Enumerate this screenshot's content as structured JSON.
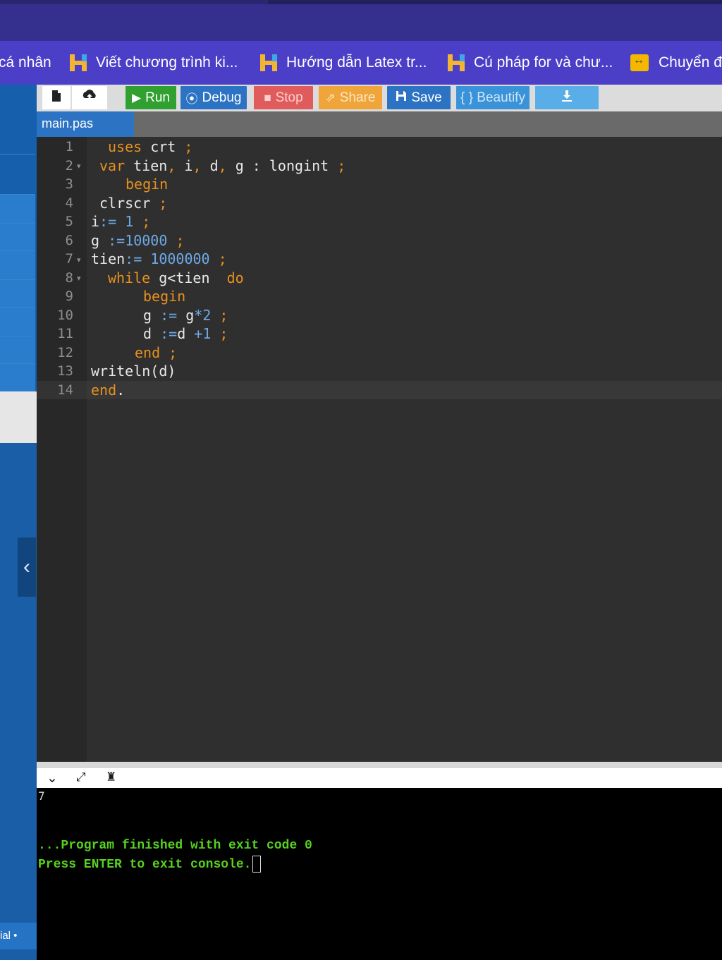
{
  "bookmarks": [
    {
      "label": "cá nhân",
      "icon": "none"
    },
    {
      "label": "Viết chương trình ki...",
      "icon": "h-logo-icon"
    },
    {
      "label": "Hướng dẫn Latex tr...",
      "icon": "h-logo-icon"
    },
    {
      "label": "Cú pháp for và chư...",
      "icon": "h-logo-icon"
    },
    {
      "label": "Chuyển đ",
      "icon": "convert-icon"
    }
  ],
  "toolbar": {
    "new_icon": "file-icon",
    "upload_icon": "upload-icon",
    "run_label": "Run",
    "debug_label": "Debug",
    "stop_label": "Stop",
    "share_label": "Share",
    "save_label": "Save",
    "beautify_label": "{ } Beautify",
    "download_icon": "download-icon",
    "colors": {
      "run": "#30a030",
      "debug": "#2c73c4",
      "stop": "#e05b5b",
      "share": "#f0a53a",
      "save": "#2c73c4",
      "beautify": "#3a93d8",
      "download": "#5aaee8"
    }
  },
  "editor": {
    "tab_label": "main.pas",
    "line_numbers": [
      "1",
      "2",
      "3",
      "4",
      "5",
      "6",
      "7",
      "8",
      "9",
      "10",
      "11",
      "12",
      "13",
      "14"
    ],
    "lines": [
      "uses crt ;",
      "var tien, i, d, g : longint ;",
      "begin",
      "clrscr ;",
      "i:= 1 ;",
      "g :=10000 ;",
      "tien:= 1000000 ;",
      "while g<tien  do",
      "begin",
      "g := g*2 ;",
      "d :=d +1 ;",
      "end ;",
      "writeln(d)",
      "end."
    ]
  },
  "console": {
    "output": "7",
    "finished": "...Program finished with exit code 0",
    "press_enter": "Press ENTER to exit console."
  },
  "sidebar": {
    "footer_text": "ial •"
  }
}
